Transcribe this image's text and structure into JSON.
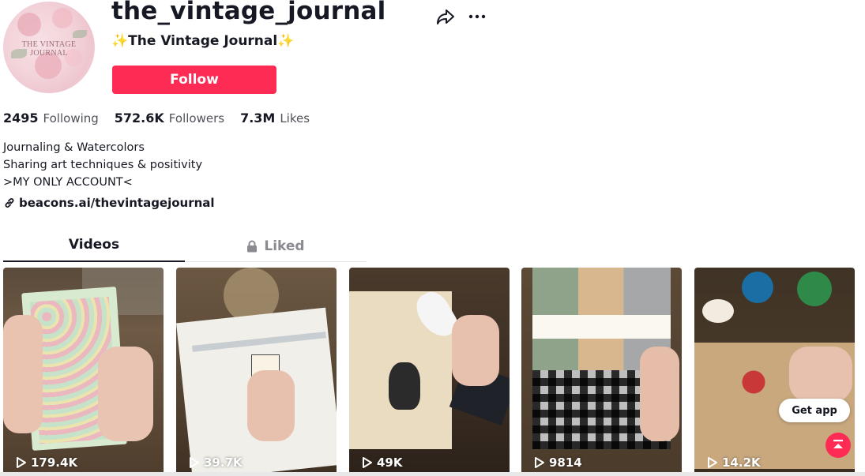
{
  "profile": {
    "username": "the_vintage_journal",
    "nickname": "✨The Vintage Journal✨",
    "avatar_text": "THE VINTAGE JOURNAL",
    "follow_label": "Follow",
    "share_icon": "share-arrow-icon",
    "more_icon": "more-dots-icon"
  },
  "stats": [
    {
      "value": "2495",
      "label": "Following"
    },
    {
      "value": "572.6K",
      "label": "Followers"
    },
    {
      "value": "7.3M",
      "label": "Likes"
    }
  ],
  "bio": {
    "line1": "Journaling & Watercolors",
    "line2": "Sharing art techniques & positivity",
    "line3": ">MY ONLY ACCOUNT<"
  },
  "link": {
    "text": "beacons.ai/thevintagejournal",
    "icon": "link-icon"
  },
  "tabs": [
    {
      "label": "Videos",
      "active": true
    },
    {
      "label": "Liked",
      "active": false,
      "icon": "lock-icon"
    }
  ],
  "videos": [
    {
      "views": "179.4K"
    },
    {
      "views": "39.7K"
    },
    {
      "views": "49K"
    },
    {
      "views": "9814"
    },
    {
      "views": "14.2K"
    }
  ],
  "overlay": {
    "get_app_label": "Get app",
    "back_to_top_icon": "back-to-top-icon"
  },
  "colors": {
    "accent": "#fe2c55",
    "text": "#161823",
    "muted": "#8a8b91"
  }
}
